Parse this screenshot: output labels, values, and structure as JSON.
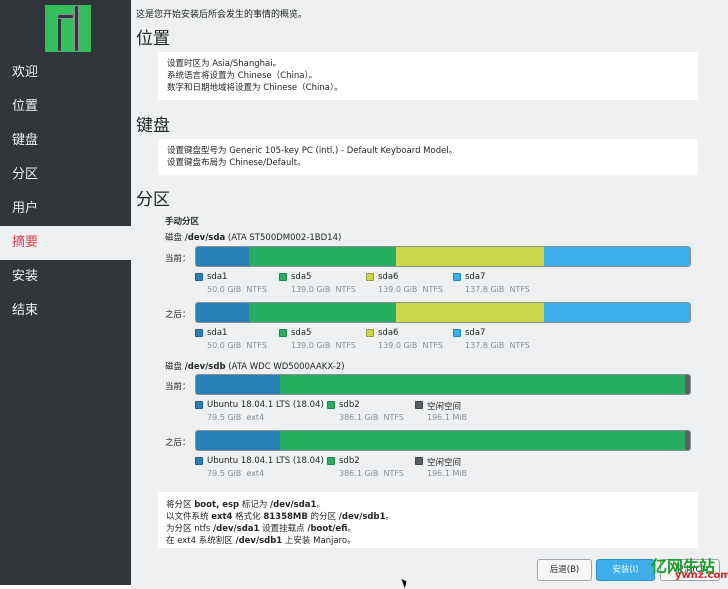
{
  "sidebar": {
    "items": [
      {
        "label": "欢迎"
      },
      {
        "label": "位置"
      },
      {
        "label": "键盘"
      },
      {
        "label": "分区"
      },
      {
        "label": "用户"
      },
      {
        "label": "摘要"
      },
      {
        "label": "安装"
      },
      {
        "label": "结束"
      }
    ],
    "active_index": 5
  },
  "main": {
    "intro": "这是您开始安装后所会发生的事情的概览。",
    "location": {
      "title": "位置",
      "lines": [
        "设置时区为 Asia/Shanghai。",
        "系统语言将设置为 Chinese（China）。",
        "数字和日期地域将设置为 Chinese（China）。"
      ]
    },
    "keyboard": {
      "title": "键盘",
      "lines": [
        "设置键盘型号为 Generic 105-key PC (intl.) - Default Keyboard Model。",
        "设置键盘布局为 Chinese/Default。"
      ]
    },
    "partition": {
      "title": "分区",
      "mode": "手动分区",
      "current_label": "当前：",
      "after_label": "之后：",
      "disks": [
        {
          "prefix": "磁盘 ",
          "device": "/dev/sda",
          "model": " (ATA ST500DM002-1BD14)",
          "partitions": [
            {
              "name": "sda1",
              "size": "50.0 GiB",
              "fs": "NTFS",
              "color": "#2980b9",
              "gib": 50.0
            },
            {
              "name": "sda5",
              "size": "139.0 GiB",
              "fs": "NTFS",
              "color": "#27ae60",
              "gib": 139.0
            },
            {
              "name": "sda6",
              "size": "139.0 GiB",
              "fs": "NTFS",
              "color": "#cdd64a",
              "gib": 139.0
            },
            {
              "name": "sda7",
              "size": "137.8 GiB",
              "fs": "NTFS",
              "color": "#3daee9",
              "gib": 137.8
            }
          ]
        },
        {
          "prefix": "磁盘 ",
          "device": "/dev/sdb",
          "model": " (ATA WDC WD5000AAKX-2)",
          "partitions": [
            {
              "name": "Ubuntu 18.04.1 LTS (18.04)",
              "size": "79.5 GiB",
              "fs": "ext4",
              "color": "#2980b9",
              "gib": 79.5
            },
            {
              "name": "sdb2",
              "size": "386.1 GiB",
              "fs": "NTFS",
              "color": "#27ae60",
              "gib": 386.1
            },
            {
              "name": "空闲空间",
              "size": "196.1 MiB",
              "fs": "",
              "color": "#5b5f63",
              "gib": 0.19
            }
          ]
        }
      ]
    },
    "summary": {
      "line1": {
        "a": "将分区 ",
        "b": "boot, esp",
        "c": " 标记为 ",
        "d": "/dev/sda1",
        "e": "。"
      },
      "line2": {
        "a": "以文件系统 ",
        "b": "ext4",
        "c": " 格式化 ",
        "d": "81358MB",
        "e": " 的分区 ",
        "f": "/dev/sdb1",
        "g": "。"
      },
      "line3": {
        "a": "为分区 ntfs ",
        "b": "/dev/sda1",
        "c": " 设置挂载点 ",
        "d": "/boot/efi",
        "e": "。"
      },
      "line4": {
        "a": "在 ext4 系统割区 ",
        "b": "/dev/sdb1",
        "c": " 上安装 Manjaro。"
      }
    }
  },
  "buttons": {
    "back": "后退(B)",
    "install": "安装(I)",
    "cancel": "取消(C)"
  },
  "watermark": {
    "main": "亿网牛站",
    "sub": "ywnz.com"
  }
}
